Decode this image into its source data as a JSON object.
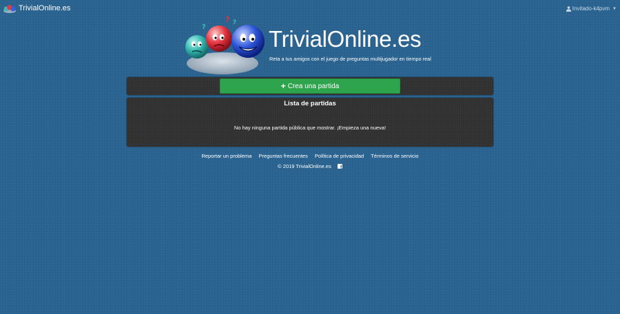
{
  "navbar": {
    "brand": "TrivialOnline.es",
    "user": "Invitado-k4pvm"
  },
  "hero": {
    "title": "TrivialOnline.es",
    "tagline": "Reta a tus amigos con el juego de preguntas multijugador en tiempo real"
  },
  "create": {
    "label": "Crea una partida"
  },
  "games": {
    "title": "Lista de partidas",
    "empty": "No hay ninguna partida pública que mostrar. ¡Empieza una nueva!"
  },
  "footer": {
    "links": [
      "Reportar un problema",
      "Preguntas frecuentes",
      "Política de privacidad",
      "Términos de servicio"
    ],
    "copyright": "© 2019 TrivialOnline.es"
  },
  "colors": {
    "background": "#2a6390",
    "panel": "#303030",
    "button": "#2ea44f"
  },
  "icons": [
    "brand-logo-icon",
    "user-icon",
    "caret-down-icon",
    "plus-icon",
    "facebook-icon"
  ]
}
